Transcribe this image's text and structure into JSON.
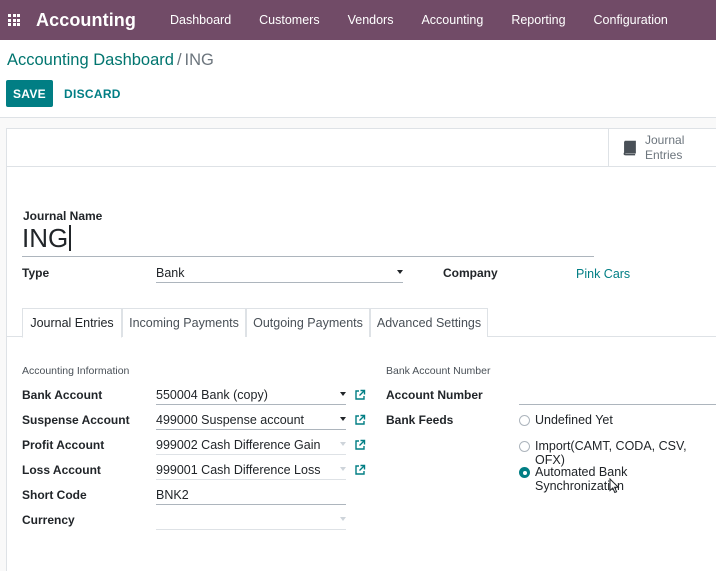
{
  "navbar": {
    "brand": "Accounting",
    "menu": [
      "Dashboard",
      "Customers",
      "Vendors",
      "Accounting",
      "Reporting",
      "Configuration"
    ]
  },
  "breadcrumb": {
    "parent": "Accounting Dashboard",
    "separator": "/",
    "current": "ING"
  },
  "actions": {
    "save": "SAVE",
    "discard": "DISCARD"
  },
  "smart_button": {
    "line1": "Journal",
    "line2": "Entries"
  },
  "form": {
    "journal_name_label": "Journal Name",
    "journal_name_value": "ING",
    "type_label": "Type",
    "type_value": "Bank",
    "company_label": "Company",
    "company_value": "Pink Cars"
  },
  "tabs": [
    "Journal Entries",
    "Incoming Payments",
    "Outgoing Payments",
    "Advanced Settings"
  ],
  "accounting": {
    "section": "Accounting Information",
    "bank_account_label": "Bank Account",
    "bank_account_value": "550004 Bank (copy)",
    "suspense_label": "Suspense Account",
    "suspense_value": "499000 Suspense account",
    "profit_label": "Profit Account",
    "profit_value": "999002 Cash Difference Gain",
    "loss_label": "Loss Account",
    "loss_value": "999001 Cash Difference Loss",
    "short_code_label": "Short Code",
    "short_code_value": "BNK2",
    "currency_label": "Currency",
    "currency_value": ""
  },
  "bank": {
    "section": "Bank Account Number",
    "account_number_label": "Account Number",
    "account_number_value": "",
    "feeds_label": "Bank Feeds",
    "options": [
      "Undefined Yet",
      "Import(CAMT, CODA, CSV, OFX)",
      "Automated Bank Synchronization"
    ],
    "selected": "Automated Bank Synchronization"
  },
  "colors": {
    "navbar": "#714b67",
    "primary": "#017e84"
  }
}
